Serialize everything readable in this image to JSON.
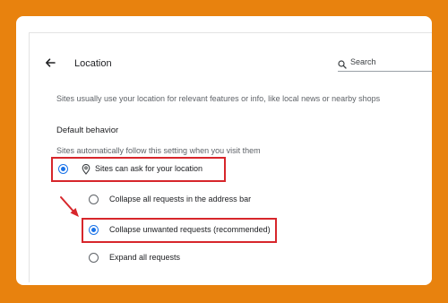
{
  "header": {
    "title": "Location",
    "search_placeholder": "Search"
  },
  "description": "Sites usually use your location for relevant features or info, like local news or nearby shops",
  "default_behavior": {
    "heading": "Default behavior",
    "subtext": "Sites automatically follow this setting when you visit them",
    "main_option": {
      "label": "Sites can ask for your location",
      "checked": true
    },
    "sub_options": [
      {
        "label": "Collapse all requests in the address bar",
        "checked": false
      },
      {
        "label": "Collapse unwanted requests (recommended)",
        "checked": true
      },
      {
        "label": "Expand all requests",
        "checked": false
      }
    ]
  },
  "colors": {
    "frame": "#E8820E",
    "accent": "#1a73e8",
    "highlight": "#D7262B"
  },
  "icons": [
    "back-arrow-icon",
    "search-icon",
    "location-pin-icon",
    "annotation-arrow"
  ]
}
